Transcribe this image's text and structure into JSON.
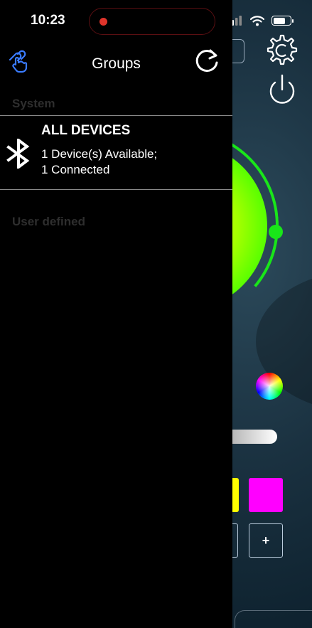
{
  "status_bar": {
    "time": "10:23"
  },
  "drawer": {
    "title": "Groups",
    "sections": {
      "system": "System",
      "user_defined": "User defined"
    },
    "groups": [
      {
        "name": "ALL DEVICES",
        "line1": "1 Device(s) Available;",
        "line2": "1 Connected",
        "icon": "bluetooth-icon"
      }
    ]
  },
  "background_app": {
    "add_label": "+",
    "colors": {
      "wheel_arc": "#19e619",
      "swatch_1": "#ffff00",
      "swatch_2": "#ff00ff"
    }
  }
}
